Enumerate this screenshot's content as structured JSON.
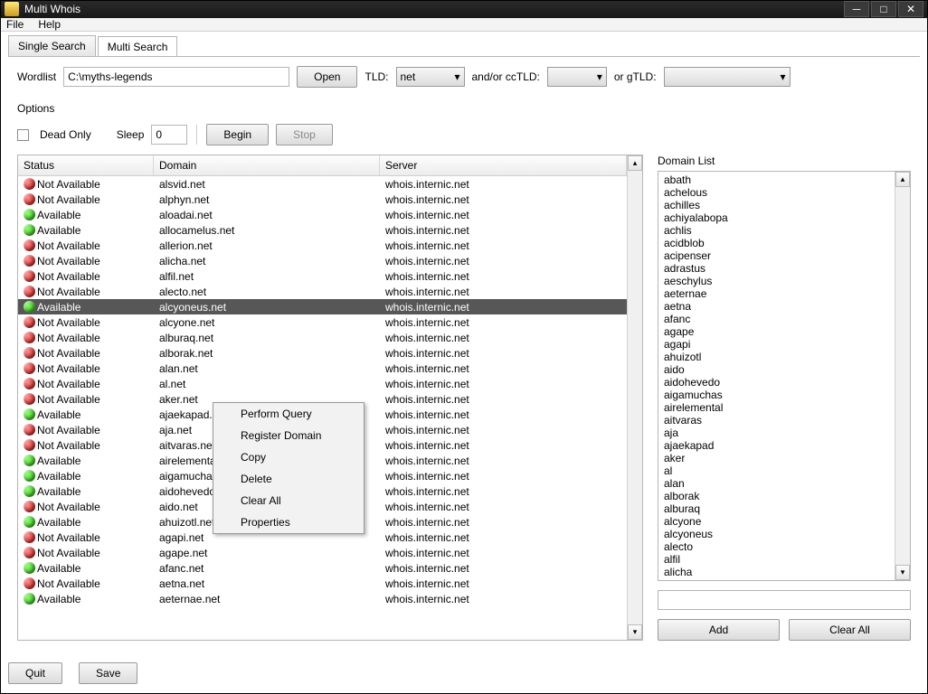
{
  "window": {
    "title": "Multi Whois"
  },
  "menubar": [
    "File",
    "Help"
  ],
  "tabs": {
    "single": "Single Search",
    "multi": "Multi Search"
  },
  "inputs": {
    "wordlist_label": "Wordlist",
    "wordlist_value": "C:\\myths-legends",
    "open": "Open",
    "tld_label": "TLD:",
    "tld_value": "net",
    "cctld_label": "and/or ccTLD:",
    "gtld_label": "or gTLD:"
  },
  "options": {
    "label": "Options",
    "dead_only": "Dead Only",
    "sleep_label": "Sleep",
    "sleep_value": "0",
    "begin": "Begin",
    "stop": "Stop"
  },
  "columns": {
    "status": "Status",
    "domain": "Domain",
    "server": "Server"
  },
  "rows": [
    {
      "status": "Not Available",
      "avail": false,
      "domain": "alsvid.net",
      "server": "whois.internic.net"
    },
    {
      "status": "Not Available",
      "avail": false,
      "domain": "alphyn.net",
      "server": "whois.internic.net"
    },
    {
      "status": "Available",
      "avail": true,
      "domain": "aloadai.net",
      "server": "whois.internic.net"
    },
    {
      "status": "Available",
      "avail": true,
      "domain": "allocamelus.net",
      "server": "whois.internic.net"
    },
    {
      "status": "Not Available",
      "avail": false,
      "domain": "allerion.net",
      "server": "whois.internic.net"
    },
    {
      "status": "Not Available",
      "avail": false,
      "domain": "alicha.net",
      "server": "whois.internic.net"
    },
    {
      "status": "Not Available",
      "avail": false,
      "domain": "alfil.net",
      "server": "whois.internic.net"
    },
    {
      "status": "Not Available",
      "avail": false,
      "domain": "alecto.net",
      "server": "whois.internic.net"
    },
    {
      "status": "Available",
      "avail": true,
      "domain": "alcyoneus.net",
      "server": "whois.internic.net",
      "selected": true
    },
    {
      "status": "Not Available",
      "avail": false,
      "domain": "alcyone.net",
      "server": "whois.internic.net"
    },
    {
      "status": "Not Available",
      "avail": false,
      "domain": "alburaq.net",
      "server": "whois.internic.net"
    },
    {
      "status": "Not Available",
      "avail": false,
      "domain": "alborak.net",
      "server": "whois.internic.net"
    },
    {
      "status": "Not Available",
      "avail": false,
      "domain": "alan.net",
      "server": "whois.internic.net"
    },
    {
      "status": "Not Available",
      "avail": false,
      "domain": "al.net",
      "server": "whois.internic.net"
    },
    {
      "status": "Not Available",
      "avail": false,
      "domain": "aker.net",
      "server": "whois.internic.net"
    },
    {
      "status": "Available",
      "avail": true,
      "domain": "ajaekapad.net",
      "server": "whois.internic.net"
    },
    {
      "status": "Not Available",
      "avail": false,
      "domain": "aja.net",
      "server": "whois.internic.net"
    },
    {
      "status": "Not Available",
      "avail": false,
      "domain": "aitvaras.net",
      "server": "whois.internic.net"
    },
    {
      "status": "Available",
      "avail": true,
      "domain": "airelemental.net",
      "server": "whois.internic.net"
    },
    {
      "status": "Available",
      "avail": true,
      "domain": "aigamuchas.net",
      "server": "whois.internic.net"
    },
    {
      "status": "Available",
      "avail": true,
      "domain": "aidohevedo.net",
      "server": "whois.internic.net"
    },
    {
      "status": "Not Available",
      "avail": false,
      "domain": "aido.net",
      "server": "whois.internic.net"
    },
    {
      "status": "Available",
      "avail": true,
      "domain": "ahuizotl.net",
      "server": "whois.internic.net"
    },
    {
      "status": "Not Available",
      "avail": false,
      "domain": "agapi.net",
      "server": "whois.internic.net"
    },
    {
      "status": "Not Available",
      "avail": false,
      "domain": "agape.net",
      "server": "whois.internic.net"
    },
    {
      "status": "Available",
      "avail": true,
      "domain": "afanc.net",
      "server": "whois.internic.net"
    },
    {
      "status": "Not Available",
      "avail": false,
      "domain": "aetna.net",
      "server": "whois.internic.net"
    },
    {
      "status": "Available",
      "avail": true,
      "domain": "aeternae.net",
      "server": "whois.internic.net"
    }
  ],
  "context_menu": [
    "Perform Query",
    "Register Domain",
    "Copy",
    "Delete",
    "Clear All",
    "Properties"
  ],
  "domain_list": {
    "label": "Domain List",
    "items": [
      "abath",
      "achelous",
      "achilles",
      "achiyalabopa",
      "achlis",
      "acidblob",
      "acipenser",
      "adrastus",
      "aeschylus",
      "aeternae",
      "aetna",
      "afanc",
      "agape",
      "agapi",
      "ahuizotl",
      "aido",
      "aidohevedo",
      "aigamuchas",
      "airelemental",
      "aitvaras",
      "aja",
      "ajaekapad",
      "aker",
      "al",
      "alan",
      "alborak",
      "alburaq",
      "alcyone",
      "alcyoneus",
      "alecto",
      "alfil",
      "alicha"
    ],
    "add": "Add",
    "clear_all": "Clear All"
  },
  "footer": {
    "quit": "Quit",
    "save": "Save"
  }
}
